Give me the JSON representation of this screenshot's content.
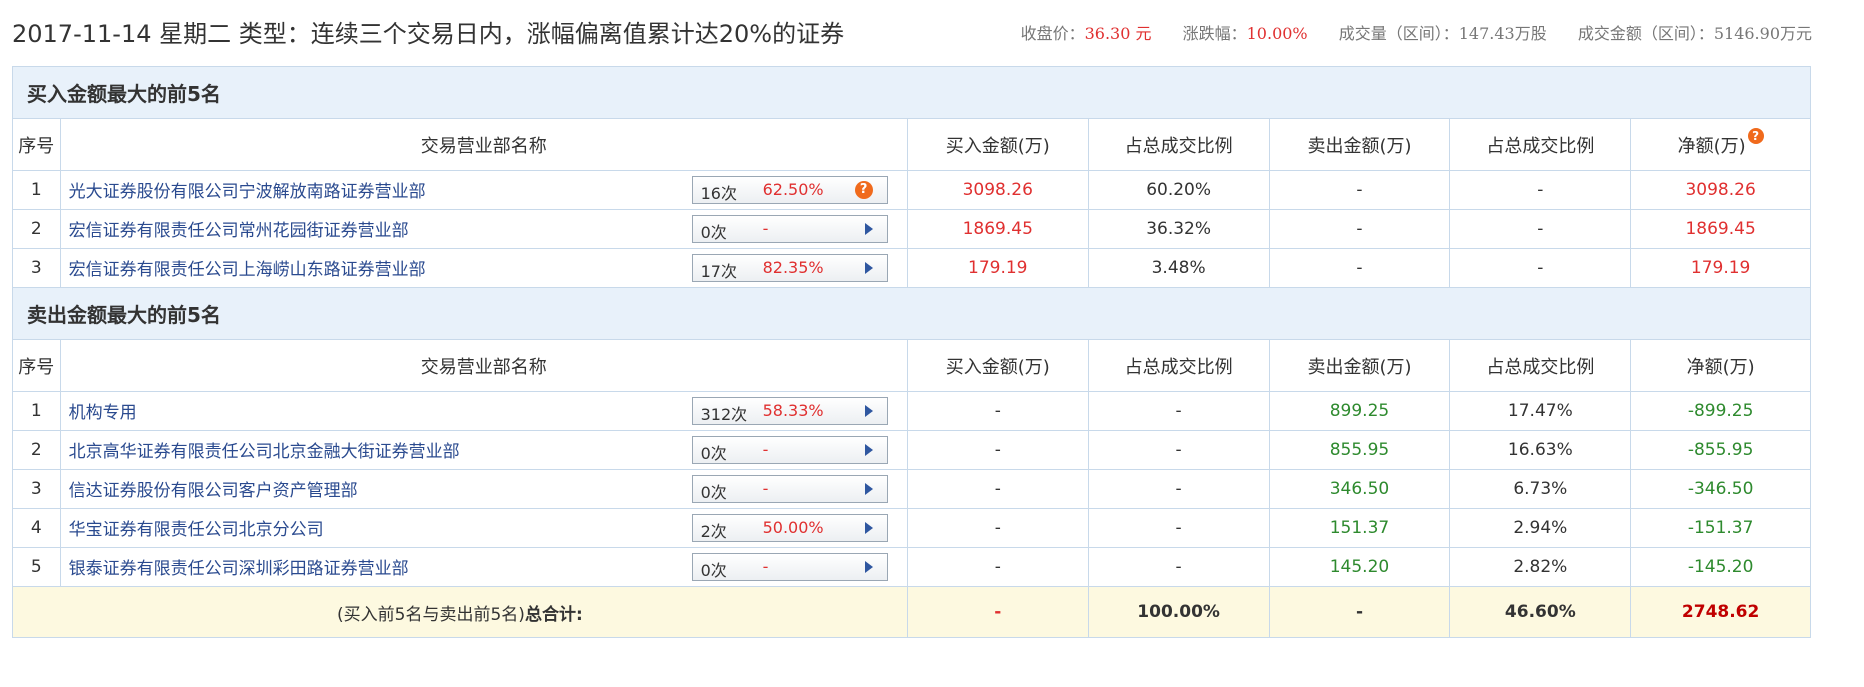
{
  "header": {
    "title": "2017-11-14 星期二  类型：连续三个交易日内，涨幅偏离值累计达20%的证券",
    "close_label": "收盘价：",
    "close_value": "36.30",
    "close_unit": " 元",
    "change_label": "涨跌幅：",
    "change_value": "10.00%",
    "volume": "成交量（区间）：147.43万股",
    "amount": "成交金额（区间）：5146.90万元"
  },
  "buy_section": {
    "title": "买入金额最大的前5名",
    "columns": [
      "序号",
      "交易营业部名称",
      "买入金额(万)",
      "占总成交比例",
      "卖出金额(万)",
      "占总成交比例",
      "净额(万)"
    ],
    "rows": [
      {
        "idx": "1",
        "name": "光大证券股份有限公司宁波解放南路证券营业部",
        "count": "16次",
        "pct": "62.50%",
        "buy": "3098.26",
        "buy_ratio": "60.20%",
        "sell": "-",
        "sell_ratio": "-",
        "net": "3098.26"
      },
      {
        "idx": "2",
        "name": "宏信证券有限责任公司常州花园街证券营业部",
        "count": "0次",
        "pct": "-",
        "buy": "1869.45",
        "buy_ratio": "36.32%",
        "sell": "-",
        "sell_ratio": "-",
        "net": "1869.45"
      },
      {
        "idx": "3",
        "name": "宏信证券有限责任公司上海崂山东路证券营业部",
        "count": "17次",
        "pct": "82.35%",
        "buy": "179.19",
        "buy_ratio": "3.48%",
        "sell": "-",
        "sell_ratio": "-",
        "net": "179.19"
      }
    ]
  },
  "sell_section": {
    "title": "卖出金额最大的前5名",
    "columns": [
      "序号",
      "交易营业部名称",
      "买入金额(万)",
      "占总成交比例",
      "卖出金额(万)",
      "占总成交比例",
      "净额(万)"
    ],
    "rows": [
      {
        "idx": "1",
        "name": "机构专用",
        "count": "312次",
        "pct": "58.33%",
        "buy": "-",
        "buy_ratio": "-",
        "sell": "899.25",
        "sell_ratio": "17.47%",
        "net": "-899.25"
      },
      {
        "idx": "2",
        "name": "北京高华证券有限责任公司北京金融大街证券营业部",
        "count": "0次",
        "pct": "-",
        "buy": "-",
        "buy_ratio": "-",
        "sell": "855.95",
        "sell_ratio": "16.63%",
        "net": "-855.95"
      },
      {
        "idx": "3",
        "name": "信达证券股份有限公司客户资产管理部",
        "count": "0次",
        "pct": "-",
        "buy": "-",
        "buy_ratio": "-",
        "sell": "346.50",
        "sell_ratio": "6.73%",
        "net": "-346.50"
      },
      {
        "idx": "4",
        "name": "华宝证券有限责任公司北京分公司",
        "count": "2次",
        "pct": "50.00%",
        "buy": "-",
        "buy_ratio": "-",
        "sell": "151.37",
        "sell_ratio": "2.94%",
        "net": "-151.37"
      },
      {
        "idx": "5",
        "name": "银泰证券有限责任公司深圳彩田路证券营业部",
        "count": "0次",
        "pct": "-",
        "buy": "-",
        "buy_ratio": "-",
        "sell": "145.20",
        "sell_ratio": "2.82%",
        "net": "-145.20"
      }
    ]
  },
  "total": {
    "label_prefix": "(买入前5名与卖出前5名)",
    "label_bold": "总合计:",
    "buy": "-",
    "buy_ratio": "100.00%",
    "sell": "-",
    "sell_ratio": "46.60%",
    "net": "2748.62"
  },
  "icons": {
    "help": "question-badge-icon",
    "expand": "triangle-right-icon"
  },
  "colors": {
    "positive": "#e03030",
    "negative": "#2e8a2e",
    "header_bg": "#e8f1fa",
    "total_bg": "#fdf9e0"
  }
}
